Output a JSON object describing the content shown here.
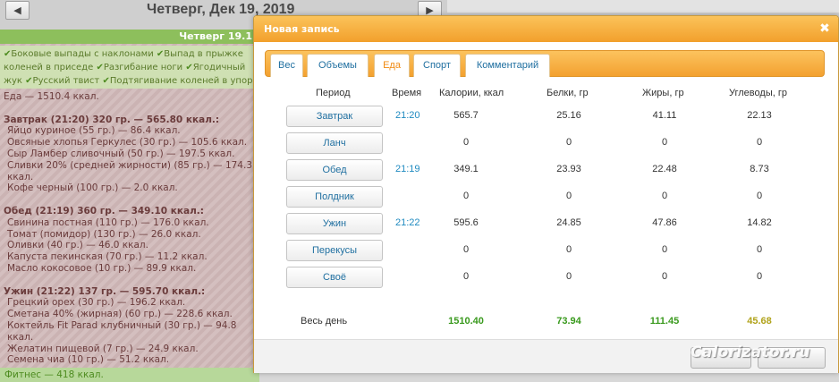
{
  "background": {
    "nav_prev_icon": "arrow-left-icon",
    "nav_next_icon": "arrow-right-icon",
    "date_title": "Четверг, Дек 19, 2019",
    "day_header": "Четверг 19.1",
    "activities": [
      "Боковые выпады с наклонами",
      "Выпад в прыжке",
      "коленей в приседе",
      "Разгибание ноги",
      "Ягодичный",
      "жук",
      "Русский твист",
      "Подтягивание коленей в упор"
    ],
    "food_total": "Еда — 1510.4 ккал.",
    "meals": [
      {
        "title": "Завтрак (21:20) 320 гр. — 565.80 ккал.:",
        "items": [
          "Яйцо куриное (55 гр.) — 86.4 ккал.",
          "Овсяные хлопья Геркулес (30 гр.) — 105.6 ккал.",
          "Сыр Ламбер сливочный (50 гр.) — 197.5 ккал.",
          "Сливки 20% (средней жирности) (85 гр.) — 174.3 ккал.",
          "Кофе черный (100 гр.) — 2.0 ккал."
        ]
      },
      {
        "title": "Обед (21:19) 360 гр. — 349.10 ккал.:",
        "items": [
          "Свинина постная (110 гр.) — 176.0 ккал.",
          "Томат (помидор) (130 гр.) — 26.0 ккал.",
          "Оливки (40 гр.) — 46.0 ккал.",
          "Капуста пекинская (70 гр.) — 11.2 ккал.",
          "Масло кокосовое (10 гр.) — 89.9 ккал."
        ]
      },
      {
        "title": "Ужин (21:22) 137 гр. — 595.70 ккал.:",
        "items": [
          "Грецкий орех (30 гр.) — 196.2 ккал.",
          "Сметана 40% (жирная) (60 гр.) — 228.6 ккал.",
          "Коктейль Fit Parad клубничный (30 гр.) — 94.8 ккал.",
          "Желатин пищевой (7 гр.) — 24.9 ккал.",
          "Семена чиа (10 гр.) — 51.2 ккал."
        ]
      }
    ],
    "fitness": "Фитнес — 418 ккал."
  },
  "modal": {
    "title": "Новая запись",
    "close_icon": "close-icon",
    "close_glyph": "✖",
    "tabs": [
      {
        "label": "Вес",
        "active": false
      },
      {
        "label": "Объемы",
        "active": false
      },
      {
        "label": "Еда",
        "active": true
      },
      {
        "label": "Спорт",
        "active": false
      },
      {
        "label": "Комментарий",
        "active": false
      }
    ],
    "columns": {
      "period": "Период",
      "time": "Время",
      "kcal": "Калории, ккал",
      "protein": "Белки, гр",
      "fat": "Жиры, гр",
      "carbs": "Углеводы, гр"
    },
    "rows": [
      {
        "period": "Завтрак",
        "time": "21:20",
        "kcal": "565.7",
        "protein": "25.16",
        "fat": "41.11",
        "carbs": "22.13"
      },
      {
        "period": "Ланч",
        "time": "",
        "kcal": "0",
        "protein": "0",
        "fat": "0",
        "carbs": "0"
      },
      {
        "period": "Обед",
        "time": "21:19",
        "kcal": "349.1",
        "protein": "23.93",
        "fat": "22.48",
        "carbs": "8.73"
      },
      {
        "period": "Полдник",
        "time": "",
        "kcal": "0",
        "protein": "0",
        "fat": "0",
        "carbs": "0"
      },
      {
        "period": "Ужин",
        "time": "21:22",
        "kcal": "595.6",
        "protein": "24.85",
        "fat": "47.86",
        "carbs": "14.82"
      },
      {
        "period": "Перекусы",
        "time": "",
        "kcal": "0",
        "protein": "0",
        "fat": "0",
        "carbs": "0"
      },
      {
        "period": "Своё",
        "time": "",
        "kcal": "0",
        "protein": "0",
        "fat": "0",
        "carbs": "0"
      }
    ],
    "total": {
      "label": "Весь день",
      "kcal": "1510.40",
      "protein": "73.94",
      "fat": "111.45",
      "carbs": "45.68"
    },
    "footer_buttons": [
      "",
      ""
    ]
  },
  "watermark": "Calorizator.ru",
  "colors": {
    "accent_orange": "#f2a02c",
    "link_blue": "#1f6fa0",
    "total_green": "#3a9a1e",
    "total_olive": "#b0a21a"
  }
}
